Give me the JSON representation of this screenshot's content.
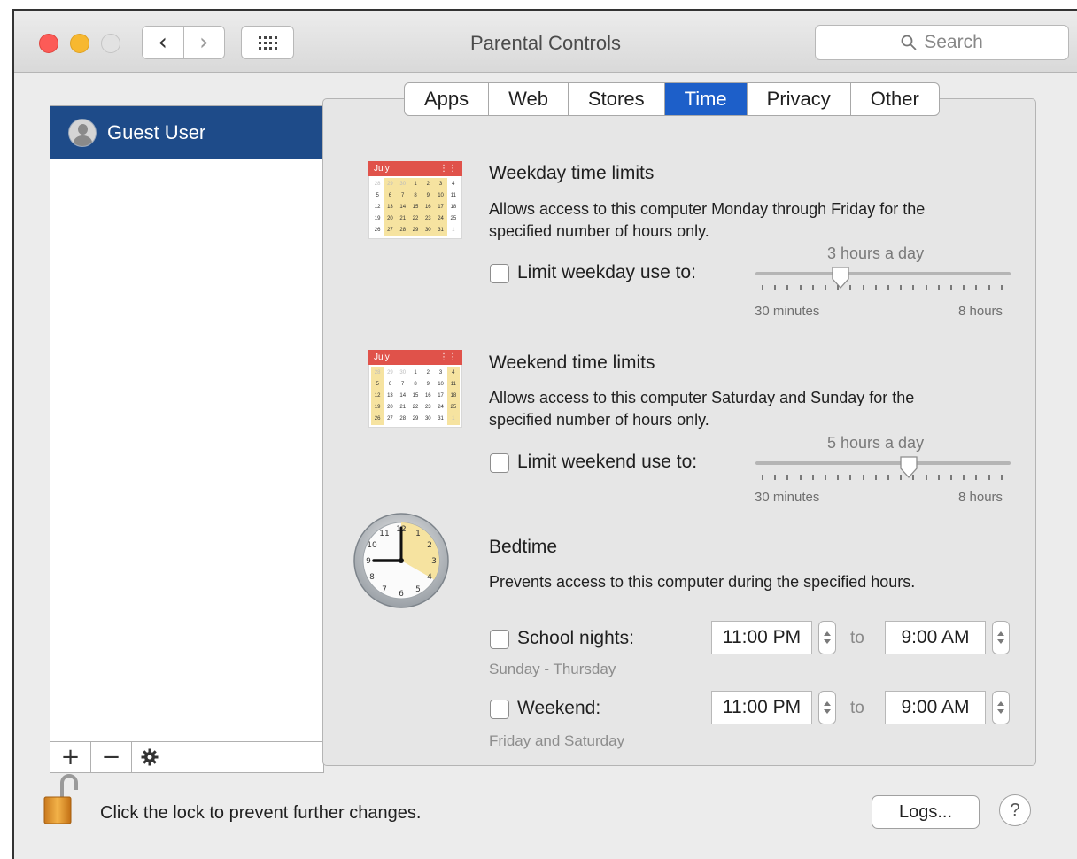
{
  "window": {
    "title": "Parental Controls",
    "search_placeholder": "Search"
  },
  "sidebar": {
    "users": [
      {
        "name": "Guest User",
        "selected": true
      }
    ],
    "add_label": "+",
    "remove_label": "−",
    "gear_icon": "gear-icon"
  },
  "tabs": [
    {
      "label": "Apps",
      "active": false
    },
    {
      "label": "Web",
      "active": false
    },
    {
      "label": "Stores",
      "active": false
    },
    {
      "label": "Time",
      "active": true
    },
    {
      "label": "Privacy",
      "active": false
    },
    {
      "label": "Other",
      "active": false
    }
  ],
  "weekday": {
    "calendar_month": "July",
    "title": "Weekday time limits",
    "description_line1": "Allows access to this computer Monday through Friday for the",
    "description_line2": "specified number of hours only.",
    "checkbox_label": "Limit weekday use to:",
    "checked": false,
    "value_label": "3 hours a day",
    "value_hours": 3,
    "min_label": "30 minutes",
    "max_label": "8 hours"
  },
  "weekend": {
    "calendar_month": "July",
    "title": "Weekend time limits",
    "description_line1": "Allows access to this computer Saturday and Sunday for the",
    "description_line2": "specified number of hours only.",
    "checkbox_label": "Limit weekend use to:",
    "checked": false,
    "value_label": "5 hours a day",
    "value_hours": 5,
    "min_label": "30 minutes",
    "max_label": "8 hours"
  },
  "bedtime": {
    "title": "Bedtime",
    "description": "Prevents access to this computer during the specified hours.",
    "school_nights": {
      "label": "School nights:",
      "sublabel": "Sunday - Thursday",
      "checked": false,
      "from": "11:00 PM",
      "to_word": "to",
      "to": "9:00 AM"
    },
    "weekend": {
      "label": "Weekend:",
      "sublabel": "Friday and Saturday",
      "checked": false,
      "from": "11:00 PM",
      "to_word": "to",
      "to": "9:00 AM"
    }
  },
  "footer": {
    "lock_text": "Click the lock to prevent further changes.",
    "logs_label": "Logs...",
    "help_label": "?"
  },
  "colors": {
    "accent": "#1d5fc9",
    "selection": "#1e4b89",
    "close": "#fc5b57",
    "minimize": "#f7b830"
  }
}
